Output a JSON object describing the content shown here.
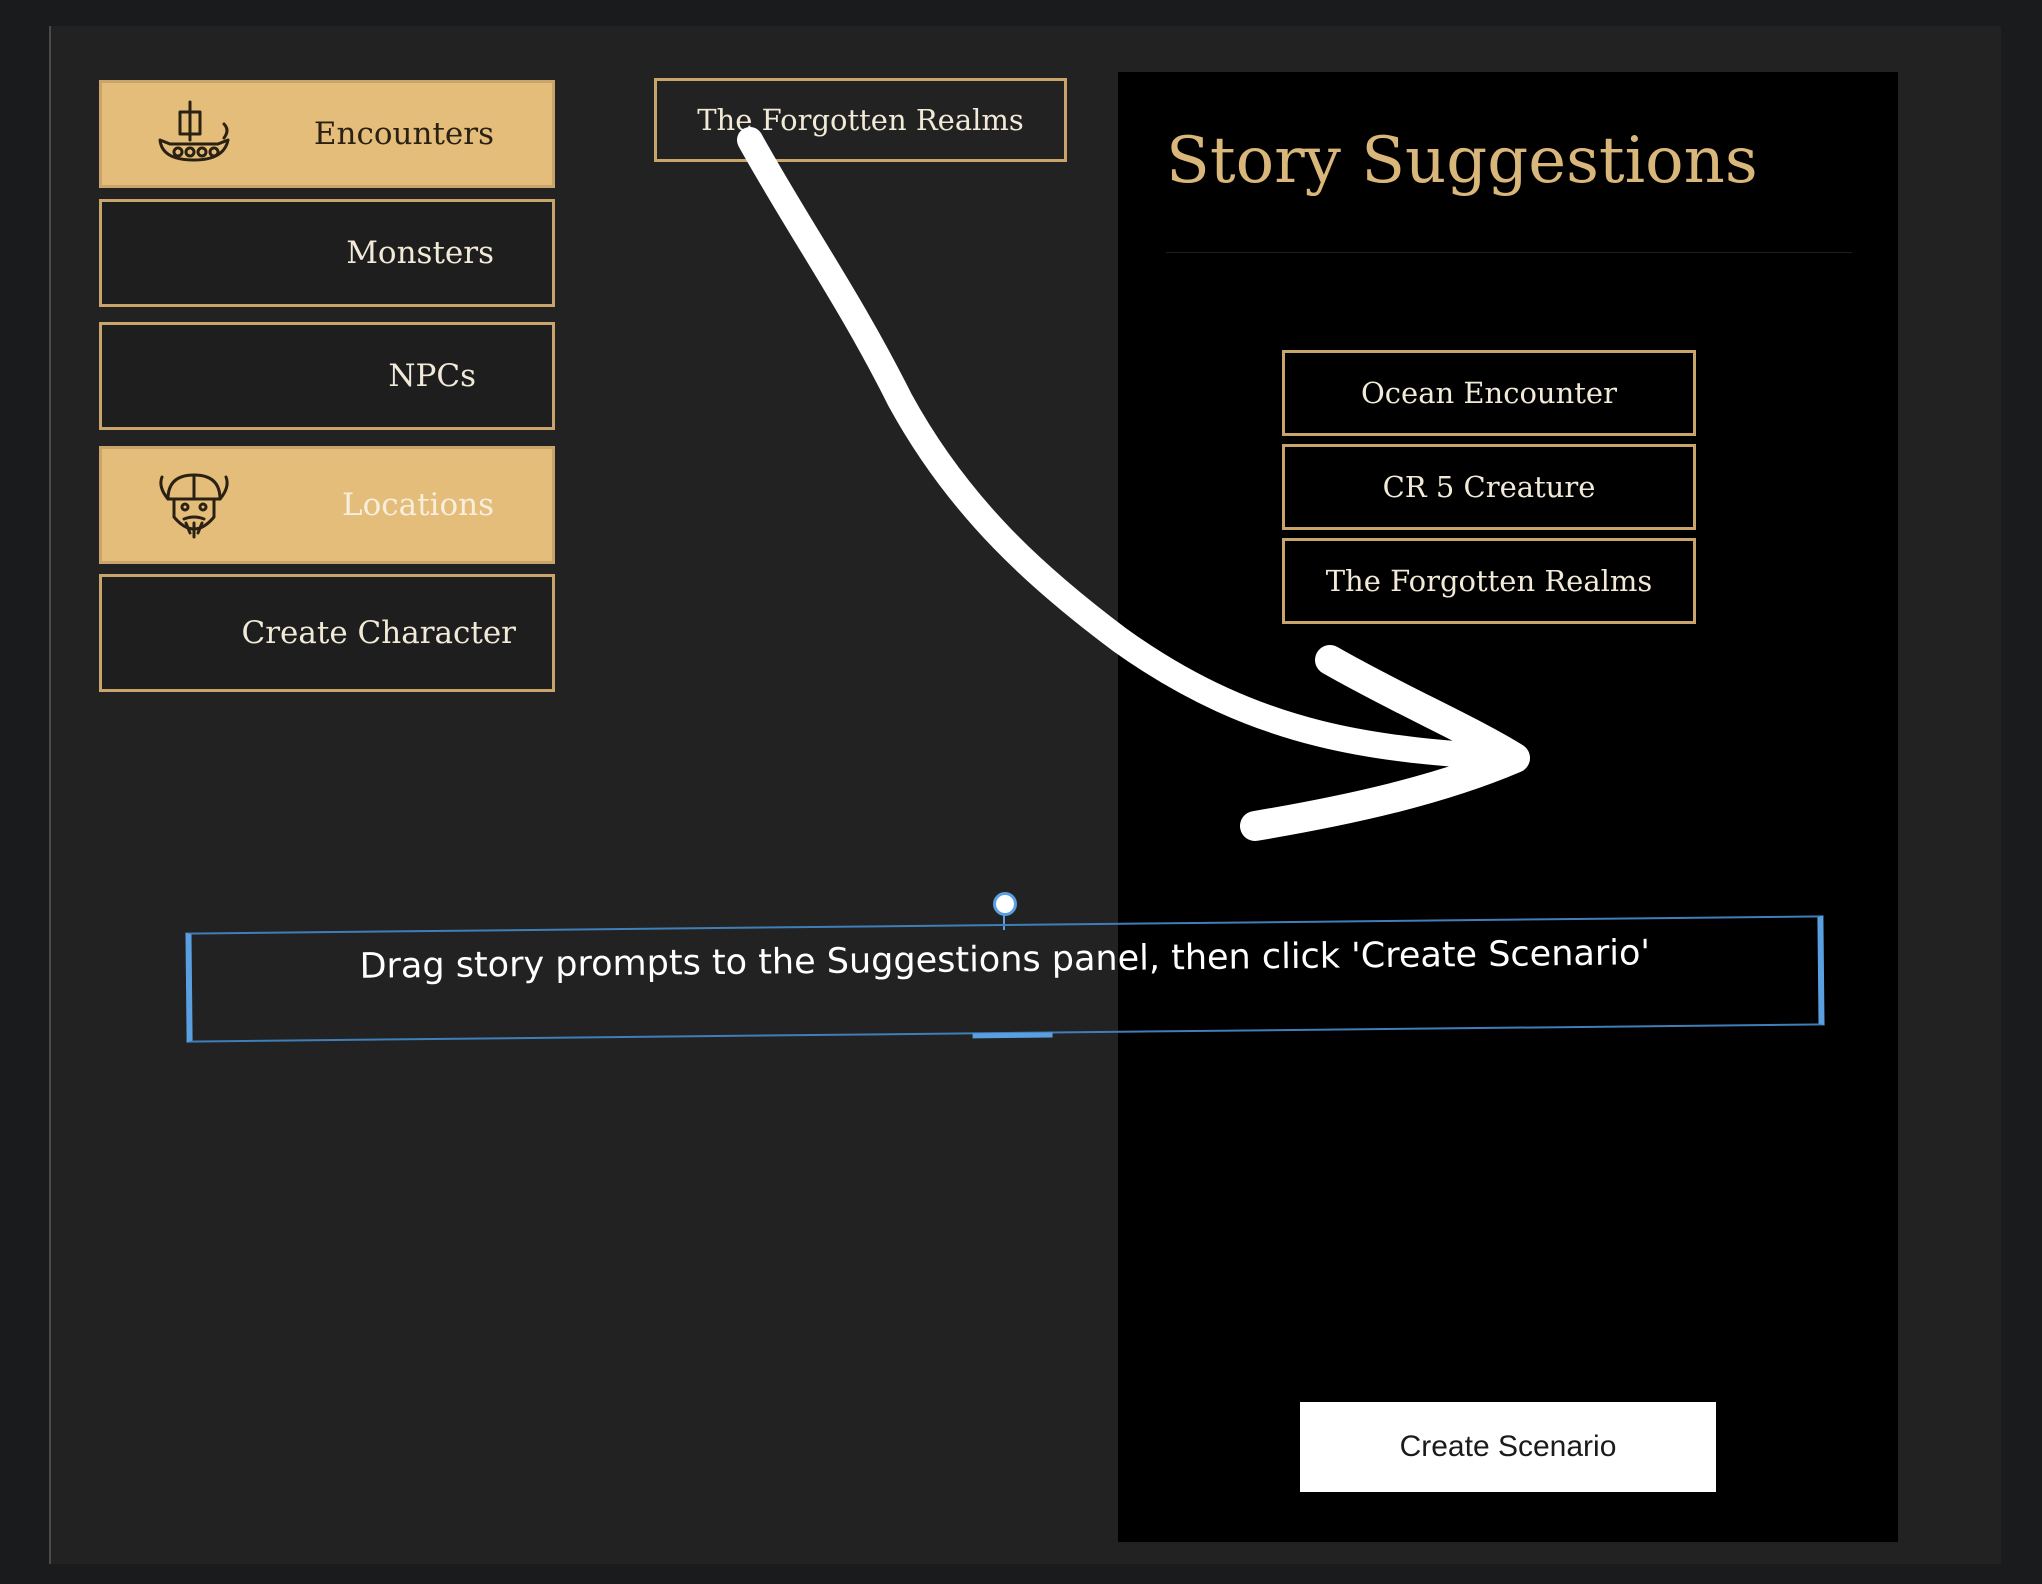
{
  "sidebar": {
    "items": [
      {
        "label": "Encounters",
        "icon": "viking-ship-icon",
        "active": true
      },
      {
        "label": "Monsters",
        "active": false
      },
      {
        "label": "NPCs",
        "active": false
      },
      {
        "label": "Locations",
        "icon": "viking-head-icon",
        "active": true
      },
      {
        "label": "Create Character",
        "active": false
      }
    ]
  },
  "dragged_chip": {
    "label": "The Forgotten Realms"
  },
  "suggestions": {
    "title": "Story Suggestions",
    "chips": [
      {
        "label": "Ocean Encounter"
      },
      {
        "label": "CR 5 Creature"
      },
      {
        "label": "The Forgotten Realms"
      }
    ],
    "create_label": "Create Scenario"
  },
  "annotation": {
    "text": "Drag story prompts to the Suggestions panel, then click 'Create Scenario'"
  },
  "colors": {
    "gold": "#c9a56b",
    "active_fill": "#e4bd7b",
    "title": "#d9b679",
    "annotation_border": "#5aa0e0"
  }
}
